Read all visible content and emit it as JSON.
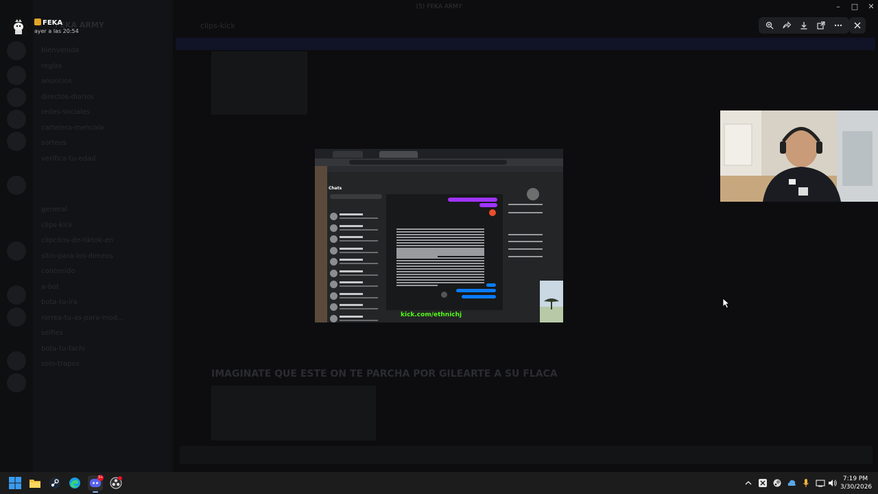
{
  "viewer": {
    "user_name": "FEKA",
    "timestamp": "ayer a las 20:54",
    "toolbar": [
      "zoom-icon",
      "reply-icon",
      "download-icon",
      "open-external-icon",
      "more-icon"
    ],
    "close_icon": "close-icon"
  },
  "window": {
    "title": "(5) FEKA ARMY",
    "controls": [
      "minimize",
      "maximize",
      "close"
    ]
  },
  "background_app": {
    "server_name": "FEKA ARMY",
    "channel_title": "clips-kick",
    "message_heading": "IMAGINATE QUE ESTE ON TE PARCHA POR GILEARTE A SU FLACA",
    "channels": [
      "bienvenida",
      "reglas",
      "anuncios",
      "directos-diarios",
      "redes-sociales",
      "cartelera-mehcala",
      "sorteos",
      "verifica-tu-edad",
      "general",
      "clips-kick",
      "clipcitos-de-tiktok-en",
      "sitio-para-los-dimeos",
      "contenido",
      "a-bot",
      "bota-tu-ira",
      "rorrea-tu-as-para-mod...",
      "selfies",
      "bota-tu-fachi",
      "solo-trapos"
    ],
    "kick_text": "kick.com/ethnichj"
  },
  "attached_image": {
    "chats_title": "Chats",
    "kick_url": "kick.com/ethnichj"
  },
  "taskbar": {
    "apps": [
      "windows-start-icon",
      "file-explorer-icon",
      "steam-icon",
      "edge-icon",
      "discord-icon",
      "obs-icon"
    ],
    "discord_badge": "3+",
    "clock_time": "7:19 PM",
    "clock_date": "3/30/2026",
    "tray": [
      "chevron-up-icon",
      "tray-app-icon",
      "steam-tray-icon",
      "network-tray-icon",
      "microphone-icon",
      "speaker-icon",
      "wifi-icon",
      "volume-icon"
    ]
  },
  "colors": {
    "kick_green": "#53fc18",
    "messenger_blue": "#0a7cff",
    "messenger_purple": "#a033ff",
    "taskbar_bg": "#1c1c1c"
  }
}
